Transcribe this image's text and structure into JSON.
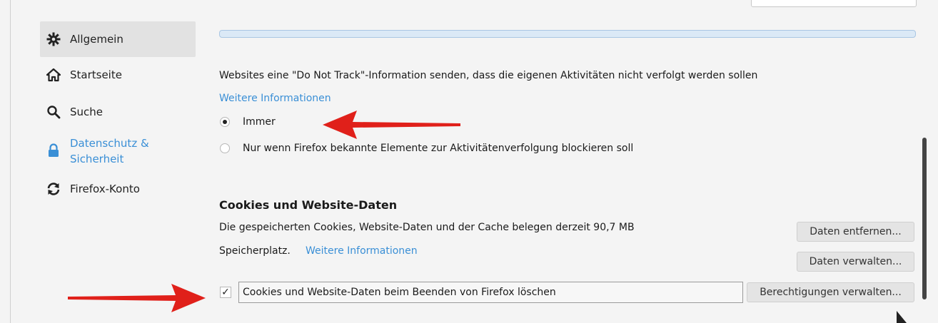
{
  "sidebar": {
    "items": [
      {
        "label": "Allgemein",
        "icon": "gear-icon"
      },
      {
        "label": "Startseite",
        "icon": "home-icon"
      },
      {
        "label": "Suche",
        "icon": "search-icon"
      },
      {
        "label": "Datenschutz & Sicherheit",
        "icon": "lock-icon"
      },
      {
        "label": "Firefox-Konto",
        "icon": "sync-icon"
      }
    ]
  },
  "tracking": {
    "description": "Websites eine \"Do Not Track\"-Information senden, dass die eigenen Aktivitäten nicht verfolgt werden sollen",
    "more_info": "Weitere Informationen",
    "options": [
      "Immer",
      "Nur wenn Firefox bekannte Elemente zur Aktivitätenverfolgung blockieren soll"
    ],
    "selected": "Immer"
  },
  "cookies": {
    "heading": "Cookies und Website-Daten",
    "usage_text": "Die gespeicherten Cookies, Website-Daten und der Cache belegen derzeit 90,7 MB",
    "usage_text2": "Speicherplatz.",
    "more_info": "Weitere Informationen",
    "clear_button": "Daten entfernen...",
    "manage_button": "Daten verwalten...",
    "checkbox_label": "Cookies und Website-Daten beim Beenden von Firefox löschen",
    "checkbox_checked": true,
    "permissions_button": "Berechtigungen verwalten..."
  },
  "colors": {
    "accent": "#3a8fd6",
    "annotation_arrow": "#e0201a"
  }
}
